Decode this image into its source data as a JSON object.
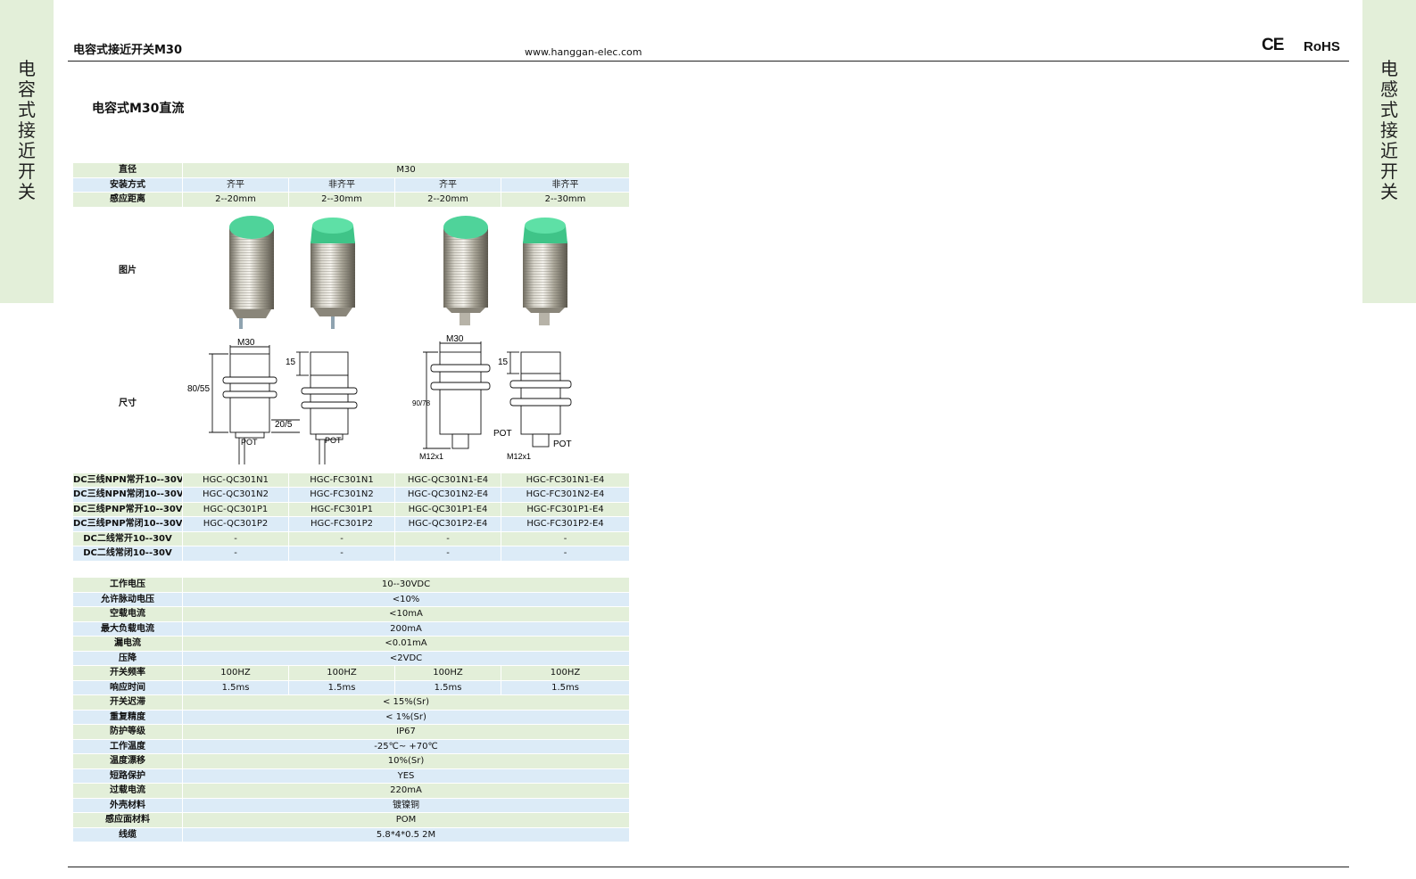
{
  "side": {
    "left_label": "电容式接近开关",
    "right_label": "电感式接近开关"
  },
  "header": {
    "title": "电容式接近开关M30",
    "url": "www.hanggan-elec.com",
    "ce": "CE",
    "rohs": "RoHS"
  },
  "section_title": "电容式M30直流",
  "colors": {
    "green_row": "#e3efd9",
    "blue_row": "#dcebf7",
    "sensor_face": "#4fd39a"
  },
  "table1": {
    "diameter": {
      "label": "直径",
      "value": "M30"
    },
    "mount": {
      "label": "安装方式",
      "values": [
        "齐平",
        "非齐平",
        "齐平",
        "非齐平"
      ]
    },
    "distance": {
      "label": "感应距离",
      "values": [
        "2--20mm",
        "2--30mm",
        "2--20mm",
        "2--30mm"
      ]
    },
    "picture_label": "图片",
    "dimension_label": "尺寸",
    "dims": {
      "m30": "M30",
      "h1": "80/55",
      "h2": "20/5",
      "top15": "15",
      "pot": "POT",
      "h3": "90/78",
      "m12": "M12x1"
    },
    "models": [
      {
        "label": "DC三线NPN常开10--30V",
        "values": [
          "HGC-QC301N1",
          "HGC-FC301N1",
          "HGC-QC301N1-E4",
          "HGC-FC301N1-E4"
        ]
      },
      {
        "label": "DC三线NPN常闭10--30V",
        "values": [
          "HGC-QC301N2",
          "HGC-FC301N2",
          "HGC-QC301N2-E4",
          "HGC-FC301N2-E4"
        ]
      },
      {
        "label": "DC三线PNP常开10--30V",
        "values": [
          "HGC-QC301P1",
          "HGC-FC301P1",
          "HGC-QC301P1-E4",
          "HGC-FC301P1-E4"
        ]
      },
      {
        "label": "DC三线PNP常闭10--30V",
        "values": [
          "HGC-QC301P2",
          "HGC-FC301P2",
          "HGC-QC301P2-E4",
          "HGC-FC301P2-E4"
        ]
      },
      {
        "label": "DC二线常开10--30V",
        "values": [
          "-",
          "-",
          "-",
          "-"
        ]
      },
      {
        "label": "DC二线常闭10--30V",
        "values": [
          "-",
          "-",
          "-",
          "-"
        ]
      }
    ]
  },
  "table2": {
    "rows_a": [
      {
        "label": "工作电压",
        "value": "10--30VDC"
      },
      {
        "label": "允许脉动电压",
        "value": "<10%"
      },
      {
        "label": "空载电流",
        "value": "<10mA"
      },
      {
        "label": "最大负载电流",
        "value": "200mA"
      },
      {
        "label": "漏电流",
        "value": "<0.01mA"
      },
      {
        "label": "压降",
        "value": "<2VDC"
      }
    ],
    "freq": {
      "label": "开关频率",
      "values": [
        "100HZ",
        "100HZ",
        "100HZ",
        "100HZ"
      ]
    },
    "resp": {
      "label": "响应时间",
      "values": [
        "1.5ms",
        "1.5ms",
        "1.5ms",
        "1.5ms"
      ]
    },
    "rows_b": [
      {
        "label": "开关迟滞",
        "value": "< 15%(Sr)"
      },
      {
        "label": "重复精度",
        "value": "< 1%(Sr)"
      },
      {
        "label": "防护等级",
        "value": "IP67"
      },
      {
        "label": "工作温度",
        "value": "-25℃~ +70℃"
      },
      {
        "label": "温度漂移",
        "value": "10%(Sr)"
      },
      {
        "label": "短路保护",
        "value": "YES"
      },
      {
        "label": "过载电流",
        "value": "220mA"
      },
      {
        "label": "外壳材料",
        "value": "镀镍铜"
      },
      {
        "label": "感应面材料",
        "value": "POM"
      },
      {
        "label": "线缆",
        "value": "5.8*4*0.5   2M"
      }
    ]
  }
}
